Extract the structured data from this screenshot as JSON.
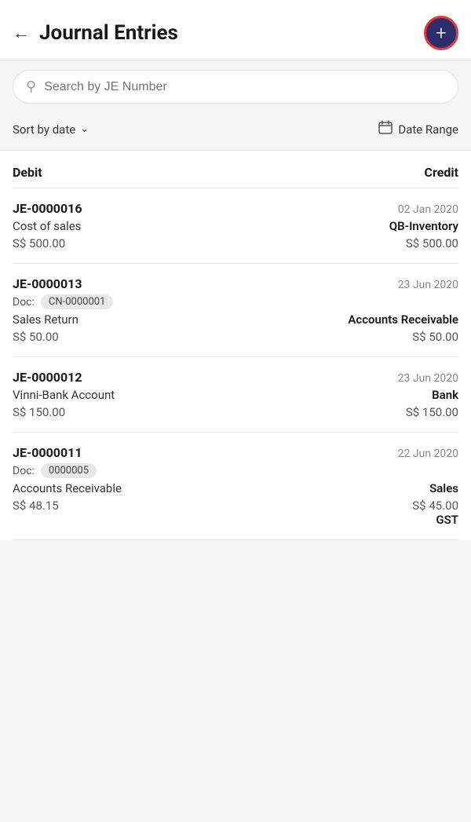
{
  "header": {
    "back_label": "←",
    "title": "Journal Entries",
    "add_button_icon": "+"
  },
  "search": {
    "placeholder": "Search by JE Number"
  },
  "filter": {
    "sort_label": "Sort by date",
    "sort_chevron": "∨",
    "date_range_label": "Date Range",
    "calendar_icon": "📅"
  },
  "columns": {
    "debit": "Debit",
    "credit": "Credit"
  },
  "entries": [
    {
      "id": "je-0000016",
      "number": "JE-0000016",
      "date": "02 Jan 2020",
      "has_doc": false,
      "doc_label": "",
      "doc_value": "",
      "debit_account": "Cost of sales",
      "credit_account": "QB-Inventory",
      "debit_amount": "S$ 500.00",
      "credit_amount": "S$ 500.00"
    },
    {
      "id": "je-0000013",
      "number": "JE-0000013",
      "date": "23 Jun 2020",
      "has_doc": true,
      "doc_label": "Doc:",
      "doc_value": "CN-0000001",
      "debit_account": "Sales Return",
      "credit_account": "Accounts Receivable",
      "debit_amount": "S$ 50.00",
      "credit_amount": "S$ 50.00"
    },
    {
      "id": "je-0000012",
      "number": "JE-0000012",
      "date": "23 Jun 2020",
      "has_doc": false,
      "doc_label": "",
      "doc_value": "",
      "debit_account": "Vinni-Bank Account",
      "credit_account": "Bank",
      "debit_amount": "S$ 150.00",
      "credit_amount": "S$ 150.00"
    },
    {
      "id": "je-0000011",
      "number": "JE-0000011",
      "date": "22 Jun 2020",
      "has_doc": true,
      "doc_label": "Doc:",
      "doc_value": "0000005",
      "debit_account": "Accounts Receivable",
      "credit_account": "Sales",
      "debit_amount": "S$ 48.15",
      "credit_amount": "S$ 45.00",
      "extra_credit": "GST"
    }
  ]
}
